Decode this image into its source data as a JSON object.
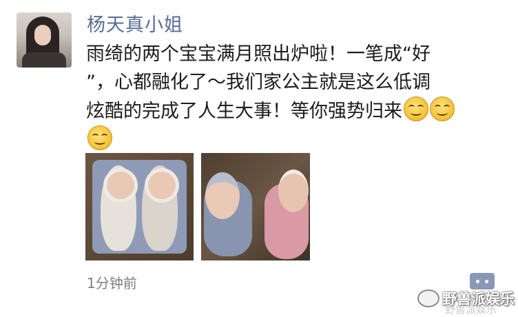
{
  "post": {
    "username": "杨天真小姐",
    "text_lines": [
      "雨绮的两个宝宝满月照出炉啦！一笔成“好",
      "”，心都融化了～我们家公主就是这么低调",
      "炫酷的完成了人生大事！等你强势归来"
    ],
    "emoji": "smile-emoji",
    "images": [
      {
        "subject": "twins-wrapped-photo"
      },
      {
        "subject": "twins-blankets-photo"
      }
    ],
    "timestamp": "1分钟前"
  },
  "watermark": {
    "main": "野兽派娱乐",
    "faint": "野兽派娱乐"
  },
  "colors": {
    "username": "#586b95",
    "text": "#1c1c1c",
    "timestamp": "#7e7e7e",
    "comment_button": "#8898b6"
  }
}
